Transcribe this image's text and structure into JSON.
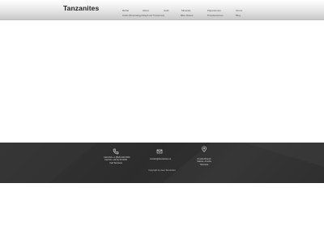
{
  "header": {
    "brand": "Tanzanites",
    "nav_row1": [
      "Home",
      "About",
      "Gold",
      "Minerals",
      "Paperstones",
      "Terms"
    ],
    "nav_row2": [
      "Artist (Mineralogy/Inlay/Lost Treasures)",
      "Blue Roses",
      "Prouderstones",
      "Blog"
    ]
  },
  "footer": {
    "phone_lines": [
      "Call USA +1 (818) 000 0000",
      "Call UK +44 (0) 00 0000",
      "Call Tanzania"
    ],
    "email": "contact@tanzanites.us",
    "address_lines": [
      "Arusha Branch",
      "Sakina, Arusha",
      "Tanzania"
    ],
    "copyright": "Copyright by dear Tanzanites"
  }
}
